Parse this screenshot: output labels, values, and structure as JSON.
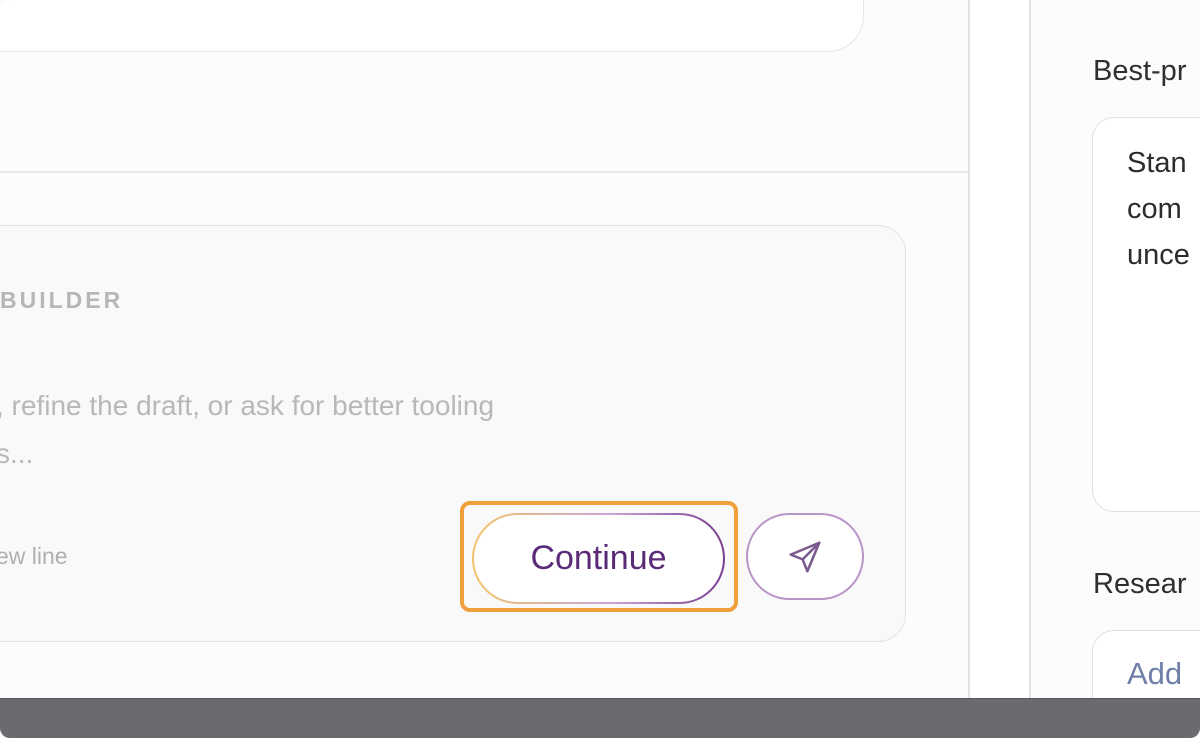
{
  "composer": {
    "label": "BUILDER",
    "placeholder": ", refine the draft, or ask for better tooling\ns...",
    "hint": "ew line",
    "continue_label": "Continue",
    "send_icon": "send-icon"
  },
  "right_panel": {
    "best_label": "Best-pr",
    "best_value": "Stan\ncom\nunce",
    "research_label": "Resear",
    "add_label": "Add"
  },
  "colors": {
    "highlight": "#f0a03a",
    "accent": "#5a2a77"
  }
}
